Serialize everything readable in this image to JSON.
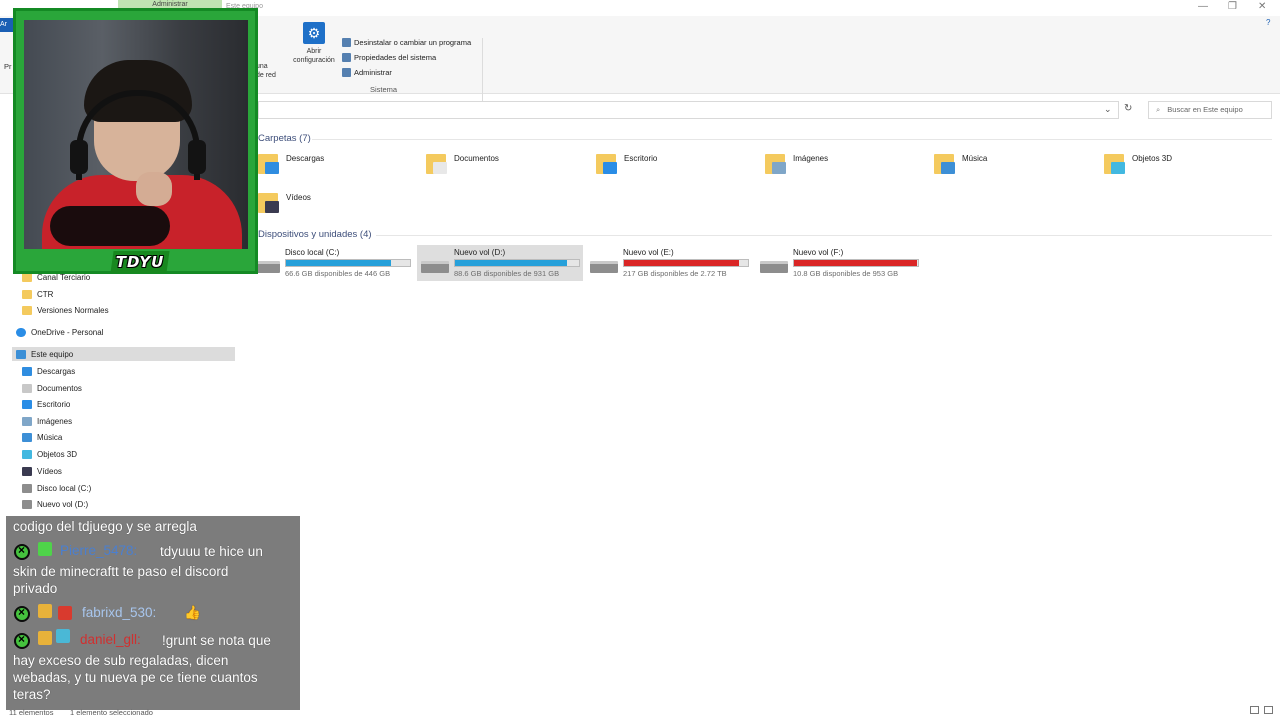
{
  "titlebar": {
    "app_tab": "Administrar",
    "title": "Este equipo",
    "controls": {
      "minimize": "—",
      "maximize": "❐",
      "close": "✕",
      "help": "?"
    }
  },
  "ribbon": {
    "tab_file": "Ar",
    "left_label": "Pr",
    "partial_button": {
      "line1": "una",
      "line2": "de red"
    },
    "open_config": {
      "line1": "Abrir",
      "line2": "configuración"
    },
    "system_items": [
      "Desinstalar o cambiar un programa",
      "Propiedades del sistema",
      "Administrar"
    ],
    "group_label": "Sistema"
  },
  "search": {
    "placeholder": "Buscar en Este equipo"
  },
  "sections": {
    "folders_title": "Carpetas (7)",
    "drives_title": "Dispositivos y unidades (4)"
  },
  "folders": [
    {
      "name": "Descargas",
      "badge_color": "#2f8de0"
    },
    {
      "name": "Documentos",
      "badge_color": "#e8e8e8"
    },
    {
      "name": "Escritorio",
      "badge_color": "#2a8de6"
    },
    {
      "name": "Imágenes",
      "badge_color": "#7fa6c8"
    },
    {
      "name": "Música",
      "badge_color": "#3d8fd6"
    },
    {
      "name": "Objetos 3D",
      "badge_color": "#42b8e0"
    },
    {
      "name": "Vídeos",
      "badge_color": "#3a3a50"
    }
  ],
  "drives": [
    {
      "name": "Disco local (C:)",
      "detail": "66.6 GB disponibles de 446 GB",
      "used_fraction": 0.85,
      "bar_color": "#26a0da",
      "selected": false
    },
    {
      "name": "Nuevo vol (D:)",
      "detail": "88.6 GB disponibles de 931 GB",
      "used_fraction": 0.9,
      "bar_color": "#26a0da",
      "selected": true
    },
    {
      "name": "Nuevo vol (E:)",
      "detail": "217 GB disponibles de 2.72 TB",
      "used_fraction": 0.93,
      "bar_color": "#da2626",
      "selected": false
    },
    {
      "name": "Nuevo vol (F:)",
      "detail": "10.8 GB disponibles de 953 GB",
      "used_fraction": 0.99,
      "bar_color": "#da2626",
      "selected": false
    }
  ],
  "nav": {
    "quick": [
      {
        "label": "Canal Terciario",
        "icon": "folder-icon",
        "color": "#f4ca5e"
      },
      {
        "label": "CTR",
        "icon": "folder-icon",
        "color": "#f4ca5e"
      },
      {
        "label": "Versiones Normales",
        "icon": "folder-icon",
        "color": "#f4ca5e"
      }
    ],
    "onedrive": "OneDrive - Personal",
    "this_pc": "Este equipo",
    "pc_items": [
      {
        "label": "Descargas",
        "icon": "download-icon",
        "color": "#2f8de0"
      },
      {
        "label": "Documentos",
        "icon": "document-icon",
        "color": "#c8c8c8"
      },
      {
        "label": "Escritorio",
        "icon": "desktop-icon",
        "color": "#2a8de6"
      },
      {
        "label": "Imágenes",
        "icon": "image-icon",
        "color": "#7fa6c8"
      },
      {
        "label": "Música",
        "icon": "music-icon",
        "color": "#3d8fd6"
      },
      {
        "label": "Objetos 3D",
        "icon": "cube-icon",
        "color": "#42b8e0"
      },
      {
        "label": "Vídeos",
        "icon": "video-icon",
        "color": "#3a3a50"
      },
      {
        "label": "Disco local (C:)",
        "icon": "drive-icon",
        "color": "#8d8d8d"
      },
      {
        "label": "Nuevo vol (D:)",
        "icon": "drive-icon",
        "color": "#8d8d8d"
      }
    ]
  },
  "status": {
    "count": "11 elementos",
    "selected": "1 elemento seleccionado"
  },
  "webcam": {
    "name": "TDYU"
  },
  "chat": {
    "line0": "codigo del tdjuego y se arregla",
    "msg1": {
      "user": "Pierre_5478:",
      "user_color": "#4a7fd0",
      "line1": "tdyuuu te hice un",
      "line2": "skin de minecraftt te paso el discord",
      "line3": "privado"
    },
    "msg2": {
      "user": "fabrixd_530:",
      "user_color": "#a8c6ee",
      "emote": "👍"
    },
    "msg3": {
      "user": "daniel_gll:",
      "user_color": "#d03030",
      "line1": "!grunt se nota que",
      "line2": "hay exceso de sub regaladas, dicen",
      "line3": "webadas, y tu nueva pe ce tiene cuantos",
      "line4": "teras?"
    }
  }
}
